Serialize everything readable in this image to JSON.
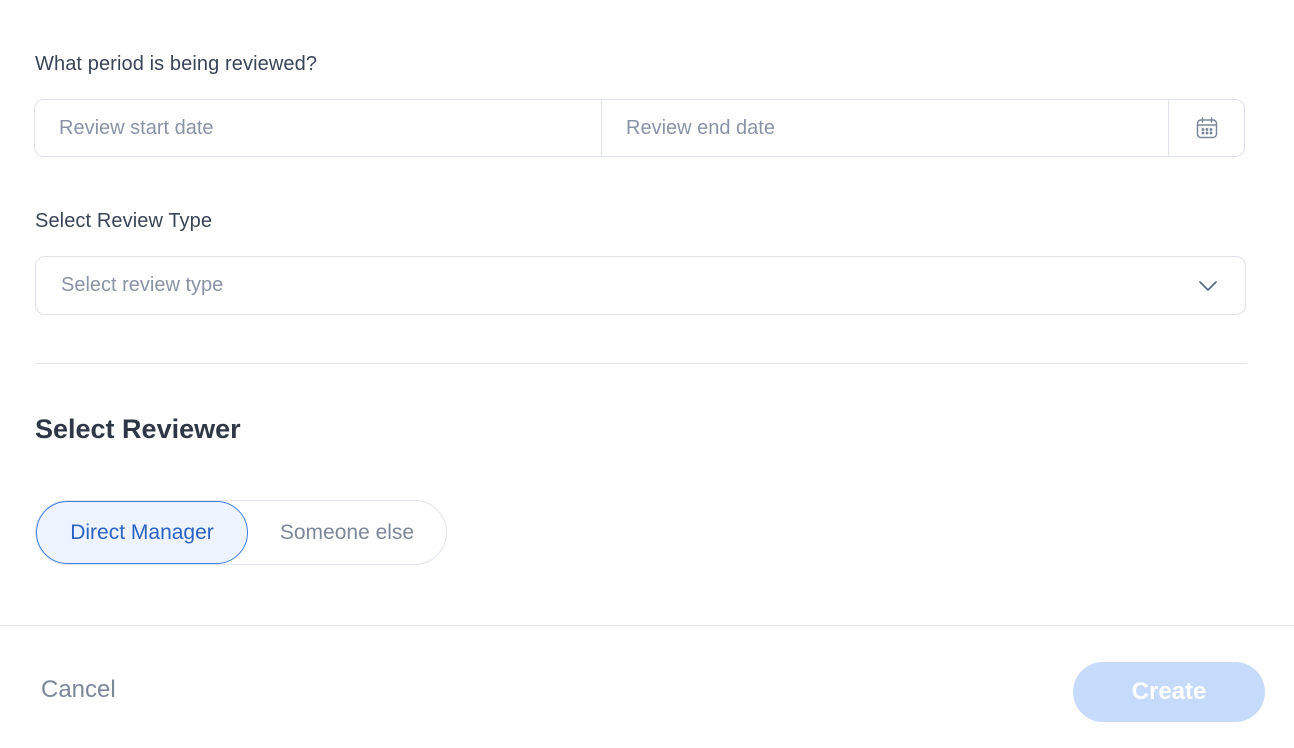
{
  "period": {
    "label": "What period is being reviewed?",
    "start_placeholder": "Review start date",
    "end_placeholder": "Review end date",
    "calendar_icon": "calendar-icon"
  },
  "review_type": {
    "label": "Select Review Type",
    "placeholder": "Select review type",
    "chevron_icon": "chevron-down-icon"
  },
  "reviewer": {
    "title": "Select Reviewer",
    "options": [
      {
        "label": "Direct Manager",
        "selected": true
      },
      {
        "label": "Someone else",
        "selected": false
      }
    ]
  },
  "footer": {
    "cancel_label": "Cancel",
    "create_label": "Create"
  },
  "colors": {
    "accent": "#3f7fe0",
    "create_disabled_bg": "#c6dbfc"
  }
}
